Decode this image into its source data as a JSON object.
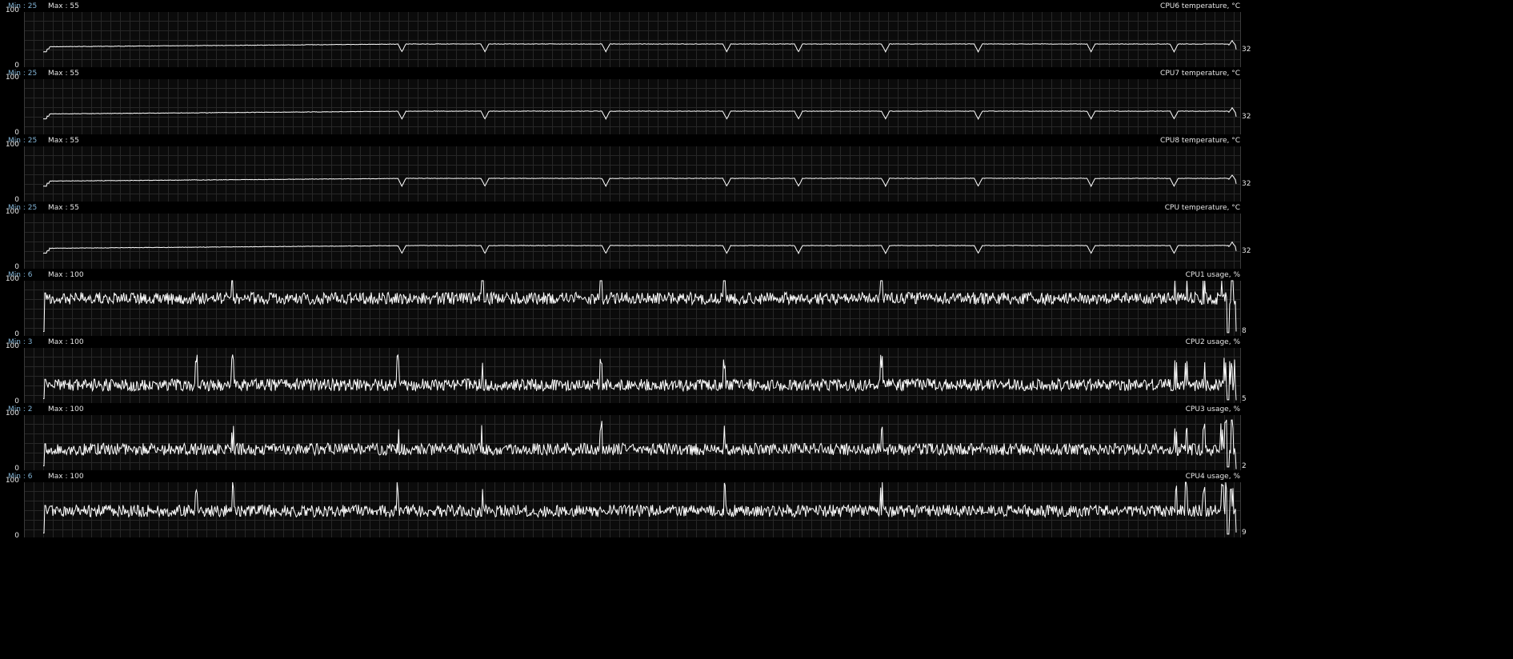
{
  "app": {
    "background": "#000000",
    "line_color": "#ffffff",
    "grid_color": "#272727",
    "min_color": "#82b4d6"
  },
  "chart_data": [
    {
      "type": "line",
      "title": "CPU6 temperature, °C",
      "min_label": "Min : 25",
      "max_label": "Max : 55",
      "ylim": [
        0,
        100
      ],
      "yticks": [
        "100",
        "0"
      ],
      "current_label": "32",
      "current": 32,
      "pattern": "temperature"
    },
    {
      "type": "line",
      "title": "CPU7 temperature, °C",
      "min_label": "Min : 25",
      "max_label": "Max : 55",
      "ylim": [
        0,
        100
      ],
      "yticks": [
        "100",
        "0"
      ],
      "current_label": "32",
      "current": 32,
      "pattern": "temperature"
    },
    {
      "type": "line",
      "title": "CPU8 temperature, °C",
      "min_label": "Min : 25",
      "max_label": "Max : 55",
      "ylim": [
        0,
        100
      ],
      "yticks": [
        "100",
        "0"
      ],
      "current_label": "32",
      "current": 32,
      "pattern": "temperature"
    },
    {
      "type": "line",
      "title": "CPU temperature, °C",
      "min_label": "Min : 25",
      "max_label": "Max : 55",
      "ylim": [
        0,
        100
      ],
      "yticks": [
        "100",
        "0"
      ],
      "current_label": "32",
      "current": 32,
      "pattern": "temperature"
    },
    {
      "type": "line",
      "title": "CPU1 usage, %",
      "min_label": "Min : 6",
      "max_label": "Max : 100",
      "ylim": [
        0,
        100
      ],
      "yticks": [
        "100",
        "0"
      ],
      "current_label": "8",
      "current": 8,
      "pattern": "usage",
      "typical": 68
    },
    {
      "type": "line",
      "title": "CPU2 usage, %",
      "min_label": "Min : 3",
      "max_label": "Max : 100",
      "ylim": [
        0,
        100
      ],
      "yticks": [
        "100",
        "0"
      ],
      "current_label": "5",
      "current": 5,
      "pattern": "usage",
      "typical": 33
    },
    {
      "type": "line",
      "title": "CPU3 usage, %",
      "min_label": "Min : 2",
      "max_label": "Max : 100",
      "ylim": [
        0,
        100
      ],
      "yticks": [
        "100",
        "0"
      ],
      "current_label": "2",
      "current": 2,
      "pattern": "usage",
      "typical": 38
    },
    {
      "type": "line",
      "title": "CPU4 usage, %",
      "min_label": "Min : 6",
      "max_label": "Max : 100",
      "ylim": [
        0,
        100
      ],
      "yticks": [
        "100",
        "0"
      ],
      "current_label": "9",
      "current": 9,
      "pattern": "usage",
      "typical": 48
    }
  ]
}
